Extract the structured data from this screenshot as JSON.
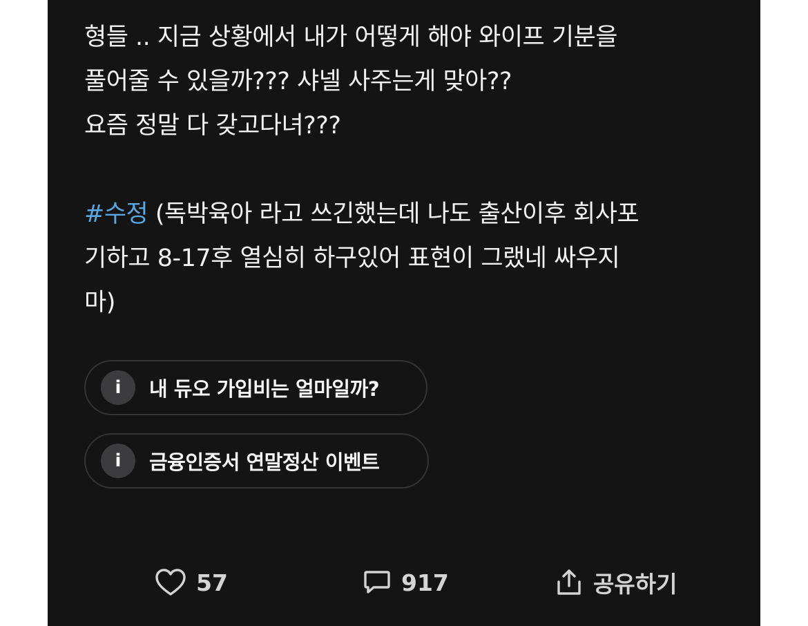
{
  "post": {
    "line1": "형들 .. 지금 상황에서 내가 어떻게 해야 와이프 기분을",
    "line2": "풀어줄 수 있을까???  샤넬 사주는게 맞아??",
    "line3": "요즘 정말 다 갖고다녀???",
    "hashtag": "#수정",
    "edit_line1": " (독박육아 라고 쓰긴했는데 나도 출산이후 회사포",
    "edit_line2": "기하고 8-17후 열심히 하구있어 표현이 그랬네 싸우지",
    "edit_line3": "마)"
  },
  "related_links": [
    {
      "icon": "info-icon",
      "glyph": "i",
      "label": "내 듀오 가입비는 얼마일까?"
    },
    {
      "icon": "info-icon",
      "glyph": "i",
      "label": "금융인증서 연말정산 이벤트"
    }
  ],
  "actions": {
    "like": {
      "icon": "heart-icon",
      "count": "57"
    },
    "comment": {
      "icon": "comment-icon",
      "count": "917"
    },
    "share": {
      "icon": "share-icon",
      "label": "공유하기"
    }
  },
  "colors": {
    "background": "#141414",
    "text": "#f2f2f2",
    "hashtag": "#5aa6e0",
    "chip_border": "#343434",
    "chip_icon_bg": "#3c3c3f",
    "action_text": "#d4d4d4"
  }
}
